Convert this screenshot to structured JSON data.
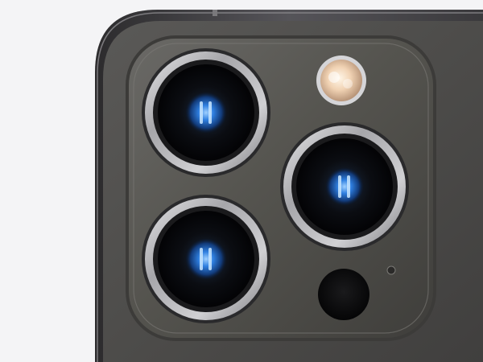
{
  "image": {
    "subject": "smartphone-rear-camera-module",
    "colors": {
      "background": "#f4f4f6",
      "body": "#4a4947",
      "frame": "#3b3a3c",
      "lens_blue": "#2f7fe0"
    }
  }
}
